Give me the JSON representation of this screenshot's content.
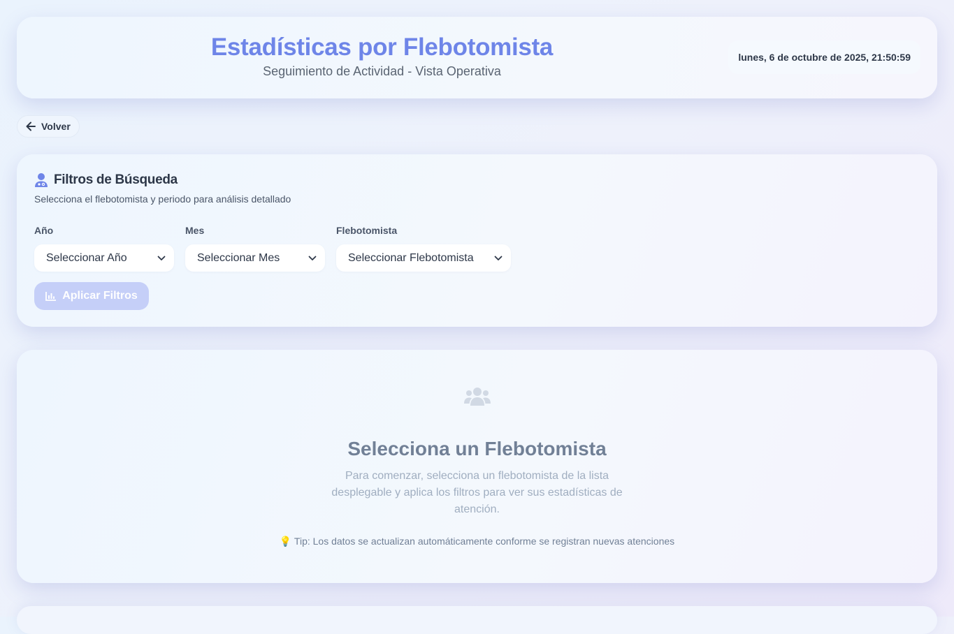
{
  "header": {
    "title": "Estadísticas por Flebotomista",
    "subtitle": "Seguimiento de Actividad - Vista Operativa",
    "datetime": "lunes, 6 de octubre de 2025, 21:50:59"
  },
  "back_button": {
    "label": "Volver",
    "icon": "arrow-left-icon"
  },
  "filters": {
    "icon": "user-doctor-icon",
    "title": "Filtros de Búsqueda",
    "description": "Selecciona el flebotomista y periodo para análisis detallado",
    "fields": [
      {
        "label": "Año",
        "value": "Seleccionar Año"
      },
      {
        "label": "Mes",
        "value": "Seleccionar Mes"
      },
      {
        "label": "Flebotomista",
        "value": "Seleccionar Flebotomista"
      }
    ],
    "apply_button": {
      "label": "Aplicar Filtros",
      "icon": "chart-bar-icon",
      "disabled": true
    }
  },
  "empty_state": {
    "icon": "users-icon",
    "title": "Selecciona un Flebotomista",
    "text": "Para comenzar, selecciona un flebotomista de la lista desplegable y aplica los filtros para ver sus estadísticas de atención.",
    "tip_icon": "💡",
    "tip": "Tip: Los datos se actualizan automáticamente conforme se registran nuevas atenciones"
  },
  "colors": {
    "accent": "#6e85e8",
    "button_disabled": "#c5cff8",
    "text_dark": "#2d3748",
    "text_muted": "#718096"
  }
}
